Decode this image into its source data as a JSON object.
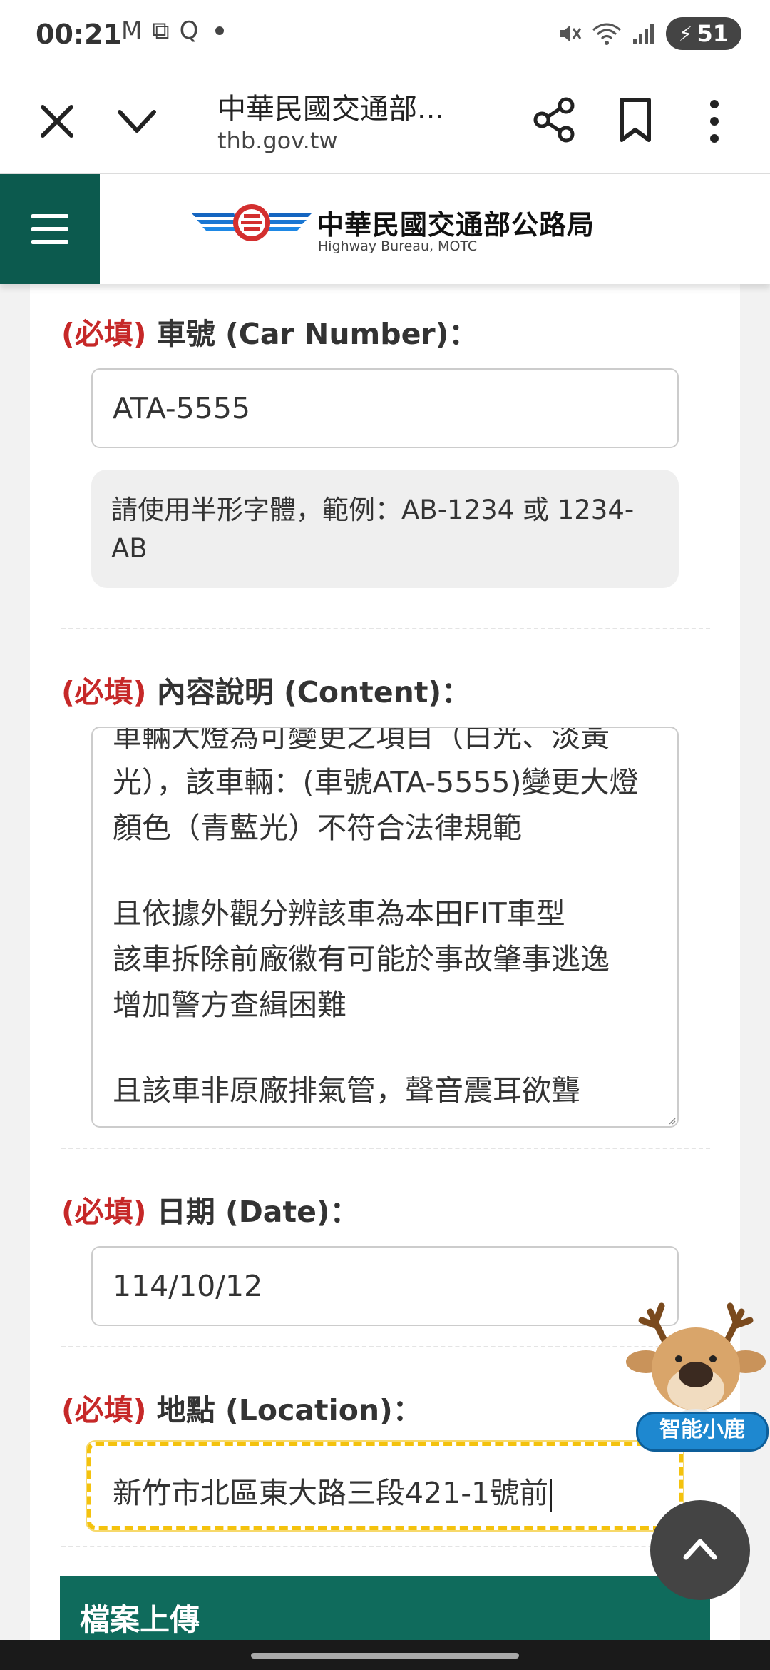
{
  "status_bar": {
    "time": "00:21",
    "battery": "51",
    "icons_left": [
      "gmail-icon",
      "screenshot-icon",
      "q-app-icon",
      "dot-icon"
    ],
    "icons_right": [
      "mute-icon",
      "wifi-icon",
      "signal-icon",
      "battery-icon"
    ]
  },
  "browser": {
    "page_title": "中華民國交通部...",
    "url": "thb.gov.tw"
  },
  "site_header": {
    "title": "中華民國交通部公路局",
    "subtitle": "Highway Bureau, MOTC",
    "brand_color": "#0c5a4e"
  },
  "form": {
    "required_tag": "(必填)",
    "car_number": {
      "label": "車號 (Car Number)：",
      "value": "ATA-5555",
      "hint_line1": "請使用半形字體，範例：AB-1234 或 1234-",
      "hint_line2": "AB"
    },
    "content": {
      "label": "內容說明 (Content)：",
      "lines": [
        "車輛大燈為可變更之項目（白光、淡黃",
        "光），該車輛：(車號ATA-5555)變更大燈",
        "顏色（青藍光）不符合法律規範",
        "",
        "且依據外觀分辨該車為本田FIT車型",
        "該車拆除前廠徽有可能於事故肇事逃逸",
        "增加警方查緝困難",
        "",
        "且該車非原廠排氣管，聲音震耳欲聾"
      ]
    },
    "date": {
      "label": "日期 (Date)：",
      "value": "114/10/12"
    },
    "location": {
      "label": "地點 (Location)：",
      "value": "新竹市北區東大路三段421-1號前"
    },
    "upload_section_title": "檔案上傳"
  },
  "mascot": {
    "label": "智能小鹿"
  }
}
